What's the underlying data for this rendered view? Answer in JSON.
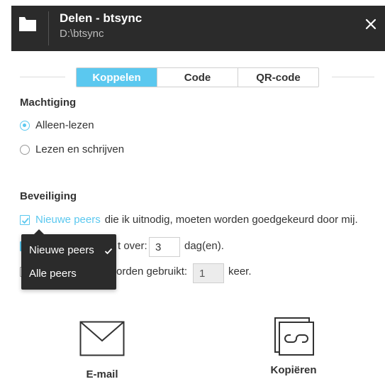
{
  "header": {
    "title": "Delen - btsync",
    "path": "D:\\btsync",
    "close_icon": "close-icon",
    "folder_icon": "folder-icon"
  },
  "tabs": [
    {
      "label": "Koppelen",
      "active": true
    },
    {
      "label": "Code",
      "active": false
    },
    {
      "label": "QR-code",
      "active": false
    }
  ],
  "permission": {
    "heading": "Machtiging",
    "options": [
      {
        "label": "Alleen-lezen",
        "selected": true
      },
      {
        "label": "Lezen en schrijven",
        "selected": false
      }
    ]
  },
  "security": {
    "heading": "Beveiliging",
    "approve_check": {
      "checked": true,
      "dropdown_value": "Nieuwe peers",
      "rest_text": "die ik uitnodig, moeten worden goedgekeurd door mij."
    },
    "expiry": {
      "visible_text": "t over:",
      "value": "3",
      "unit": "dag(en)."
    },
    "uses": {
      "visible_text": "orden gebruikt:",
      "value": "1",
      "unit": "keer."
    }
  },
  "dropdown_menu": {
    "options": [
      {
        "label": "Nieuwe peers",
        "selected": true
      },
      {
        "label": "Alle peers",
        "selected": false
      }
    ]
  },
  "actions": {
    "email": {
      "label": "E-mail",
      "icon": "envelope-icon"
    },
    "copy": {
      "label": "Kopiëren",
      "icon": "copy-link-icon"
    }
  },
  "colors": {
    "accent": "#5bc8ef",
    "header_bg": "#2b2b2b",
    "menu_bg": "#2b2b2b"
  }
}
